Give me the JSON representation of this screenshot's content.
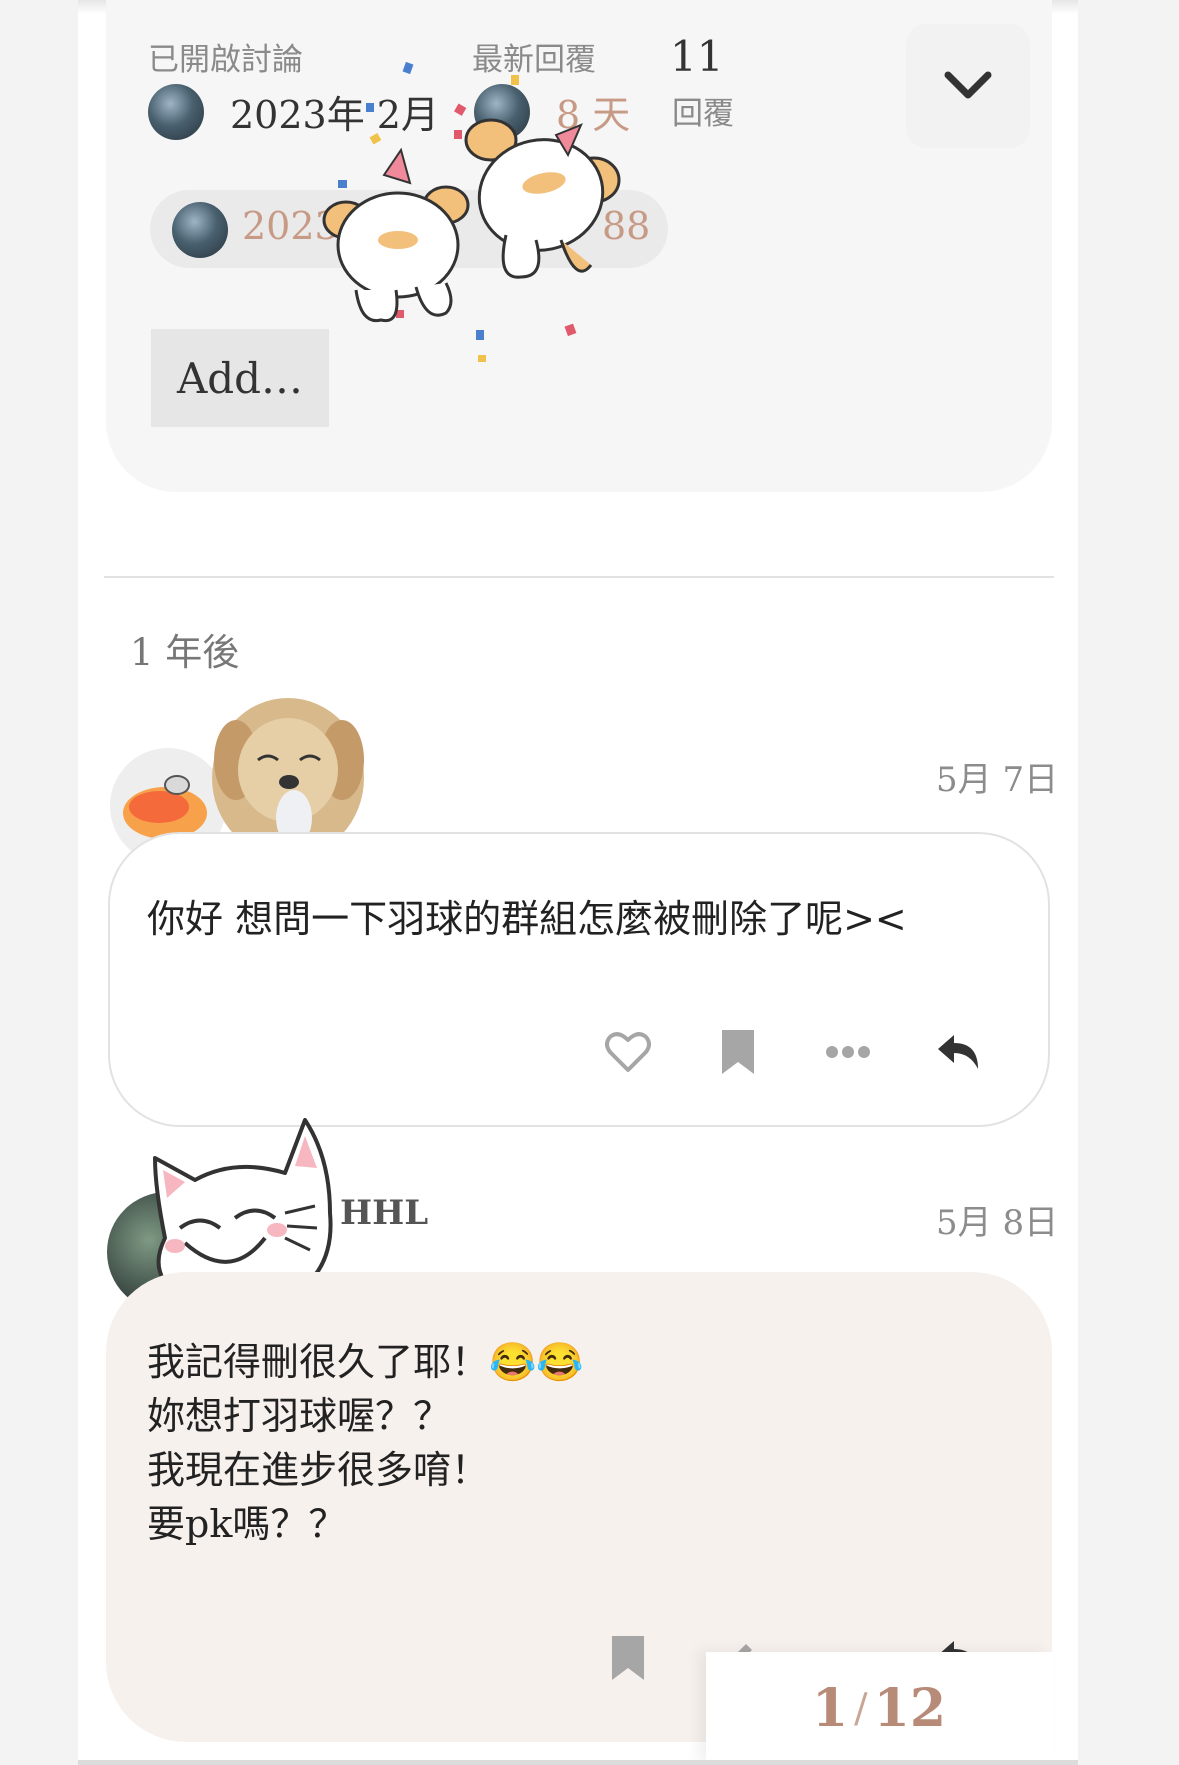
{
  "summary": {
    "created_label": "已開啟討論",
    "created_value": "2023年 2月",
    "latest_label": "最新回覆",
    "latest_value": "8 天",
    "replies_count": "11",
    "replies_label": "回覆",
    "pill_date": "2023",
    "pill_count": "88",
    "add_button": "Add…"
  },
  "time_gap": "1 年後",
  "posts": [
    {
      "date": "5月 7日",
      "text": "你好 想問一下羽球的群組怎麼被刪除了呢><"
    },
    {
      "username": "HHL",
      "date": "5月 8日",
      "lines": [
        "我記得刪很久了耶！😂😂",
        "妳想打羽球喔？？",
        "我現在進步很多唷！",
        "要pk嗎？？"
      ]
    }
  ],
  "counter": {
    "current": "1",
    "separator": "/",
    "total": "12"
  },
  "colors": {
    "accent": "#c79a86",
    "reply_bg": "#f7f1ee"
  },
  "icons": [
    "chevron-down-icon",
    "heart-icon",
    "bookmark-icon",
    "more-icon",
    "reply-icon",
    "edit-icon"
  ]
}
